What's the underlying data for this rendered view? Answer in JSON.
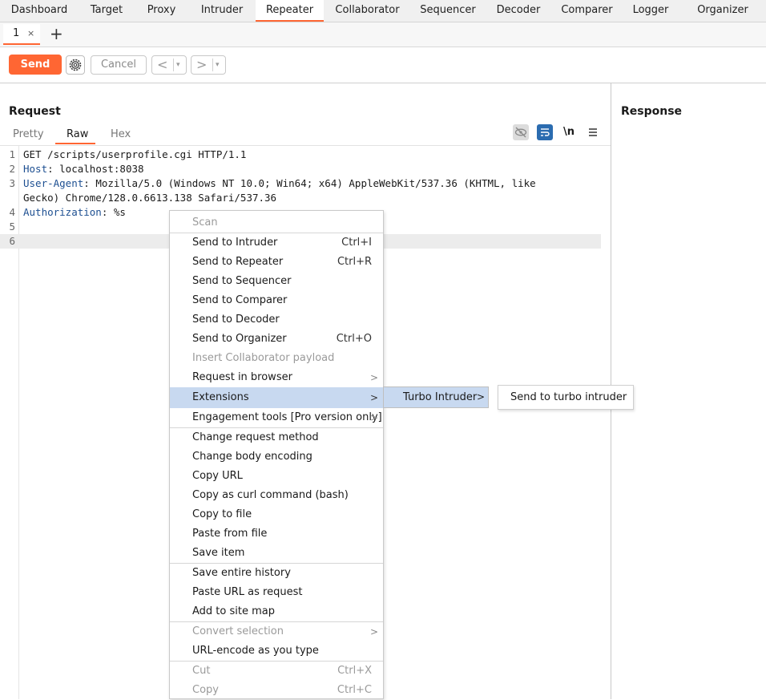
{
  "nav": {
    "tabs": [
      "Dashboard",
      "Target",
      "Proxy",
      "Intruder",
      "Repeater",
      "Collaborator",
      "Sequencer",
      "Decoder",
      "Comparer",
      "Logger",
      "Organizer"
    ],
    "active": "Repeater"
  },
  "subtabs": {
    "tab_label": "1",
    "close": "×",
    "add": "+"
  },
  "toolbar": {
    "send": "Send",
    "cancel": "Cancel",
    "back": "<",
    "forward": ">",
    "dropdown": "▾"
  },
  "request": {
    "title": "Request",
    "view_tabs": [
      "Pretty",
      "Raw",
      "Hex"
    ],
    "active_view": "Raw",
    "newline_toggle": "\\n",
    "lines": [
      {
        "n": "1",
        "text": "GET /scripts/userprofile.cgi HTTP/1.1"
      },
      {
        "n": "2",
        "name": "Host",
        "value": ": localhost:8038"
      },
      {
        "n": "3",
        "name": "User-Agent",
        "value": ": Mozilla/5.0 (Windows NT 10.0; Win64; x64) AppleWebKit/537.36 (KHTML, like"
      },
      {
        "n": "",
        "text": "Gecko) Chrome/128.0.6613.138 Safari/537.36"
      },
      {
        "n": "4",
        "name": "Authorization",
        "value": ": %s"
      },
      {
        "n": "5",
        "text": ""
      },
      {
        "n": "6",
        "text": ""
      }
    ]
  },
  "response": {
    "title": "Response"
  },
  "context_menu": {
    "items": [
      {
        "label": "Scan",
        "disabled": true
      },
      {
        "label": "Send to Intruder",
        "shortcut": "Ctrl+I"
      },
      {
        "label": "Send to Repeater",
        "shortcut": "Ctrl+R"
      },
      {
        "label": "Send to Sequencer"
      },
      {
        "label": "Send to Comparer"
      },
      {
        "label": "Send to Decoder"
      },
      {
        "label": "Send to Organizer",
        "shortcut": "Ctrl+O"
      },
      {
        "label": "Insert Collaborator payload",
        "disabled": true
      },
      {
        "label": "Request in browser",
        "submenu": true
      },
      {
        "label": "Extensions",
        "submenu": true,
        "selected": true
      },
      {
        "label": "Engagement tools [Pro version only]",
        "submenu": true
      },
      {
        "label": "Change request method"
      },
      {
        "label": "Change body encoding"
      },
      {
        "label": "Copy URL"
      },
      {
        "label": "Copy as curl command (bash)"
      },
      {
        "label": "Copy to file"
      },
      {
        "label": "Paste from file"
      },
      {
        "label": "Save item"
      },
      {
        "label": "Save entire history"
      },
      {
        "label": "Paste URL as request"
      },
      {
        "label": "Add to site map"
      },
      {
        "label": "Convert selection",
        "submenu": true,
        "disabled": true
      },
      {
        "label": "URL-encode as you type"
      },
      {
        "label": "Cut",
        "shortcut": "Ctrl+X",
        "disabled": true
      },
      {
        "label": "Copy",
        "shortcut": "Ctrl+C",
        "disabled": true
      }
    ],
    "submenu_arrow": ">"
  },
  "extensions_submenu": {
    "label": "Turbo Intruder",
    "arrow": ">"
  },
  "turbo_submenu": {
    "label": "Send to turbo intruder"
  },
  "colors": {
    "accent": "#ff6633",
    "selected": "#c8d9f0",
    "header_name": "#1d4f91"
  }
}
